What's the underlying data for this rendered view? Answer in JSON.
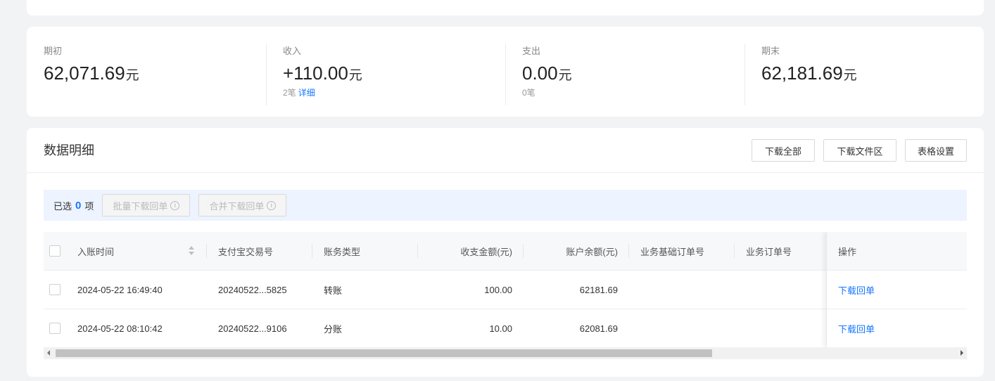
{
  "summary": {
    "opening": {
      "label": "期初",
      "amount": "62,071.69",
      "unit": "元"
    },
    "income": {
      "label": "收入",
      "amount": "+110.00",
      "unit": "元",
      "count": "2笔",
      "detail_link": "详细"
    },
    "expense": {
      "label": "支出",
      "amount": "0.00",
      "unit": "元",
      "count": "0笔"
    },
    "closing": {
      "label": "期末",
      "amount": "62,181.69",
      "unit": "元"
    }
  },
  "detail": {
    "title": "数据明细",
    "buttons": {
      "download_all": "下载全部",
      "download_area": "下载文件区",
      "table_settings": "表格设置"
    },
    "selection": {
      "prefix": "已选",
      "count": "0",
      "suffix": "项",
      "batch_download": "批量下载回单",
      "merge_download": "合并下载回单",
      "info_glyph": "i"
    }
  },
  "table": {
    "columns": [
      "入账时间",
      "支付宝交易号",
      "账务类型",
      "收支金额(元)",
      "账户余额(元)",
      "业务基础订单号",
      "业务订单号",
      "操作"
    ],
    "rows": [
      {
        "time": "2024-05-22 16:49:40",
        "trade_no": "20240522...5825",
        "type": "转账",
        "amount": "100.00",
        "balance": "62181.69",
        "base_order": "",
        "order": "",
        "action": "下载回单"
      },
      {
        "time": "2024-05-22 08:10:42",
        "trade_no": "20240522...9106",
        "type": "分账",
        "amount": "10.00",
        "balance": "62081.69",
        "base_order": "",
        "order": "",
        "action": "下载回单"
      }
    ]
  },
  "scroll": {
    "thumb_fraction": 0.73
  },
  "icons": {
    "sort": "sort-icon",
    "info": "info-icon",
    "checkbox": "checkbox"
  },
  "colors": {
    "link": "#1677ff",
    "selection_bar": "#edf3ff",
    "page_bg": "#f2f3f5"
  }
}
